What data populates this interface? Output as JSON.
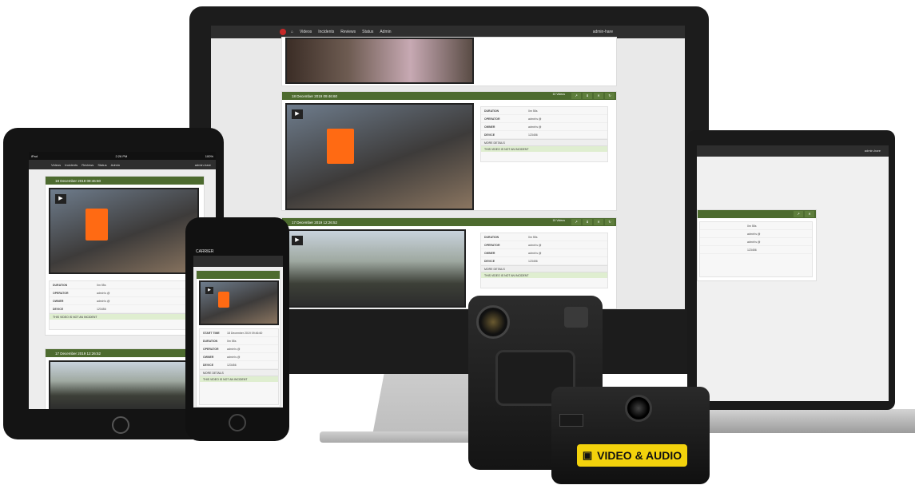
{
  "app": {
    "nav": [
      "Videos",
      "Incidents",
      "Reviews",
      "Status",
      "Admin"
    ],
    "user": "admin-hare"
  },
  "cards": {
    "card1_title": "18 December 2019 09:46:60",
    "card2_title": "17 December 2019 12:26:52",
    "card2_count": "15 Videos",
    "card1_count": "10 Videos"
  },
  "meta": {
    "duration_label": "DURATION",
    "duration": "0m 55s",
    "operator_label": "OPERATOR",
    "operator": "admin's @",
    "owner_label": "OWNER",
    "owner": "admin's @",
    "device_label": "DEVICE",
    "device": "123456",
    "start_label": "START TIME",
    "start": "18 December 2019 09:46:60",
    "more_details": "MORE DETAILS",
    "linked": "THIS VIDEO IS NOT AN INCIDENT"
  },
  "ipad": {
    "status_left": "iPad",
    "status_time": "2:26 PM",
    "status_right": "100%"
  },
  "iphone": {
    "carrier": "CARRIER"
  },
  "camera": {
    "label": "VIDEO & AUDIO"
  }
}
